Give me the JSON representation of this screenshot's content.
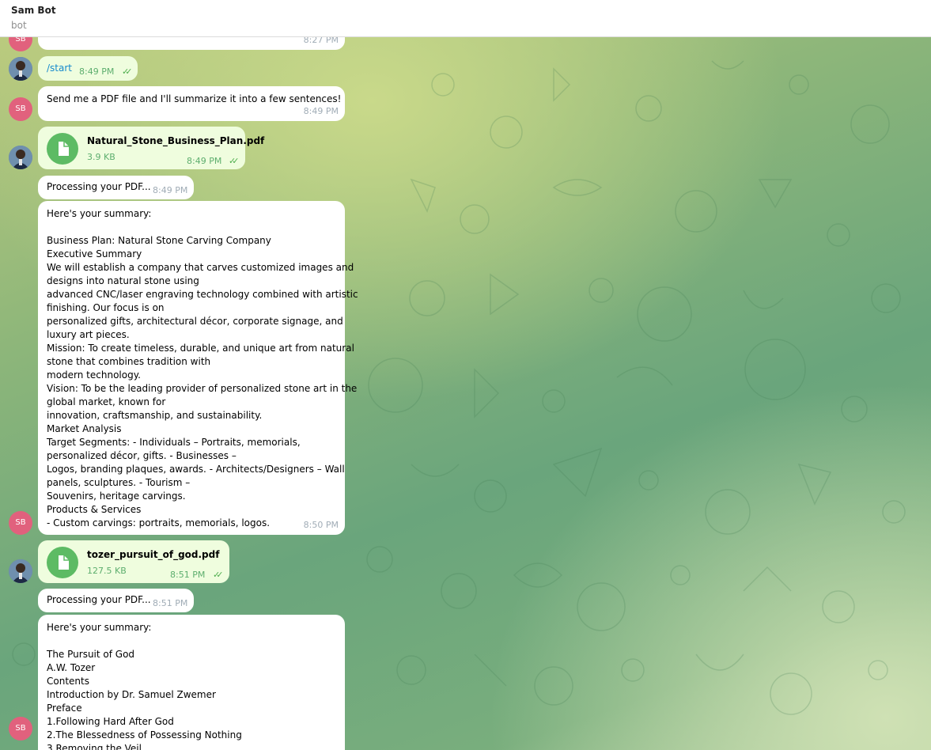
{
  "header": {
    "title": "Sam Bot",
    "status": "bot"
  },
  "avatars": {
    "bot_initials": "SB"
  },
  "messages": {
    "m0": {
      "time": "8:27 PM"
    },
    "m1": {
      "text": "/start",
      "time": "8:49 PM",
      "read": true
    },
    "m2": {
      "text": "Send me a PDF file and I'll summarize it into a few sentences!",
      "time": "8:49 PM"
    },
    "m3": {
      "file_name": "Natural_Stone_Business_Plan.pdf",
      "file_size": "3.9 KB",
      "time": "8:49 PM",
      "read": true
    },
    "m4": {
      "text": "Processing your PDF...",
      "time": "8:49 PM"
    },
    "m5": {
      "time": "8:50 PM",
      "lines": [
        "Here's your summary:",
        "",
        "Business Plan: Natural Stone Carving Company",
        "Executive Summary",
        "We will establish a company that carves customized images and",
        "designs into natural stone using",
        "advanced CNC/laser engraving technology combined with artistic",
        "finishing. Our focus is on",
        "personalized gifts, architectural décor, corporate signage, and",
        "luxury art pieces.",
        "Mission: To create timeless, durable, and unique art from natural",
        "stone that combines tradition with",
        "modern technology.",
        "Vision: To be the leading provider of personalized stone art in the",
        "global market, known for",
        "innovation, craftsmanship, and sustainability.",
        "Market Analysis",
        "Target Segments: - Individuals – Portraits, memorials,",
        "personalized décor, gifts. - Businesses –",
        "Logos, branding plaques, awards. - Architects/Designers – Wall",
        "panels, sculptures. - Tourism –",
        "Souvenirs, heritage carvings.",
        "Products & Services",
        "- Custom carvings: portraits, memorials, logos."
      ]
    },
    "m6": {
      "file_name": "tozer_pursuit_of_god.pdf",
      "file_size": "127.5 KB",
      "time": "8:51 PM",
      "read": true
    },
    "m7": {
      "text": "Processing your PDF...",
      "time": "8:51 PM"
    },
    "m8": {
      "lines": [
        "Here's your summary:",
        "",
        "The Pursuit of God",
        "A.W. Tozer",
        "Contents",
        "Introduction by Dr. Samuel Zwemer",
        "Preface",
        "1.Following Hard After God",
        "2.The Blessedness of Possessing Nothing",
        "3.Removing the Veil"
      ]
    }
  },
  "colors": {
    "incoming": "#ffffff",
    "outgoing": "#effdde",
    "accent": "#5dbb64",
    "avatar_bot": "#e1617d"
  },
  "icons": {
    "file": "file-icon",
    "read_receipt": "double-check-icon"
  }
}
